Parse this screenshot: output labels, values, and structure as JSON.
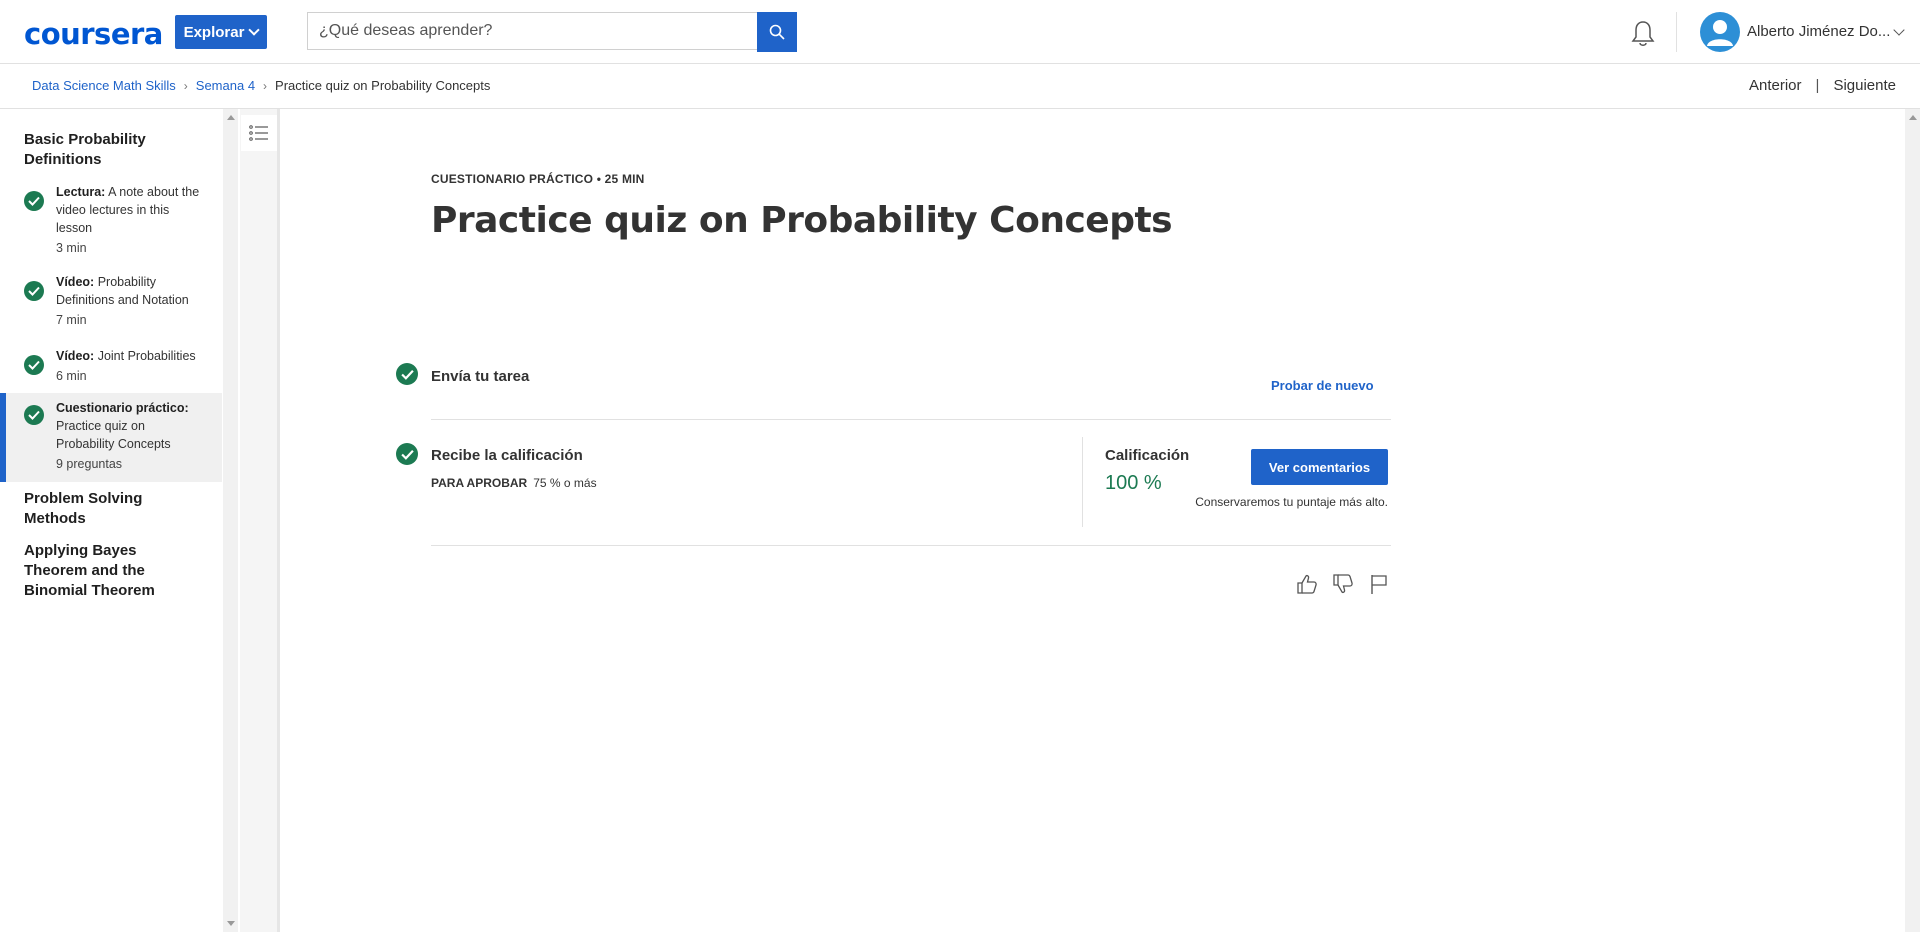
{
  "header": {
    "logo": "coursera",
    "explore_label": "Explorar",
    "search_placeholder": "¿Qué deseas aprender?",
    "username": "Alberto Jiménez Do..."
  },
  "breadcrumb": {
    "items": [
      "Data Science Math Skills",
      "Semana 4"
    ],
    "current": "Practice quiz on Probability Concepts"
  },
  "nav": {
    "previous": "Anterior",
    "separator": "|",
    "next": "Siguiente"
  },
  "sidebar": {
    "sections": [
      {
        "title": "Basic Probability Definitions",
        "items": [
          {
            "type": "Lectura:",
            "title": "A note about the video lectures in this lesson",
            "duration": "3 min",
            "done": true
          },
          {
            "type": "Vídeo:",
            "title": "Probability Definitions and Notation",
            "duration": "7 min",
            "done": true
          },
          {
            "type": "Vídeo:",
            "title": "Joint Probabilities",
            "duration": "6 min",
            "done": true
          },
          {
            "type": "Cuestionario práctico:",
            "title": "Practice quiz on Probability Concepts",
            "duration": "9 preguntas",
            "done": true,
            "active": true
          }
        ]
      },
      {
        "title": "Problem Solving Methods"
      },
      {
        "title": "Applying Bayes Theorem and the Binomial Theorem"
      }
    ]
  },
  "main": {
    "kicker": "CUESTIONARIO PRÁCTICO • 25 MIN",
    "title": "Practice quiz on Probability Concepts",
    "submit_step": "Envía tu tarea",
    "retry": "Probar de nuevo",
    "receive_step": "Recibe la calificación",
    "pass_label": "PARA APROBAR",
    "pass_value": "75 % o más",
    "grade_label": "Calificación",
    "grade_value": "100 %",
    "feedback_button": "Ver comentarios",
    "keep_note": "Conservaremos tu puntaje más alto."
  },
  "colors": {
    "accent": "#1f63c9",
    "success": "#1c7a52",
    "brand": "#0056d2"
  }
}
